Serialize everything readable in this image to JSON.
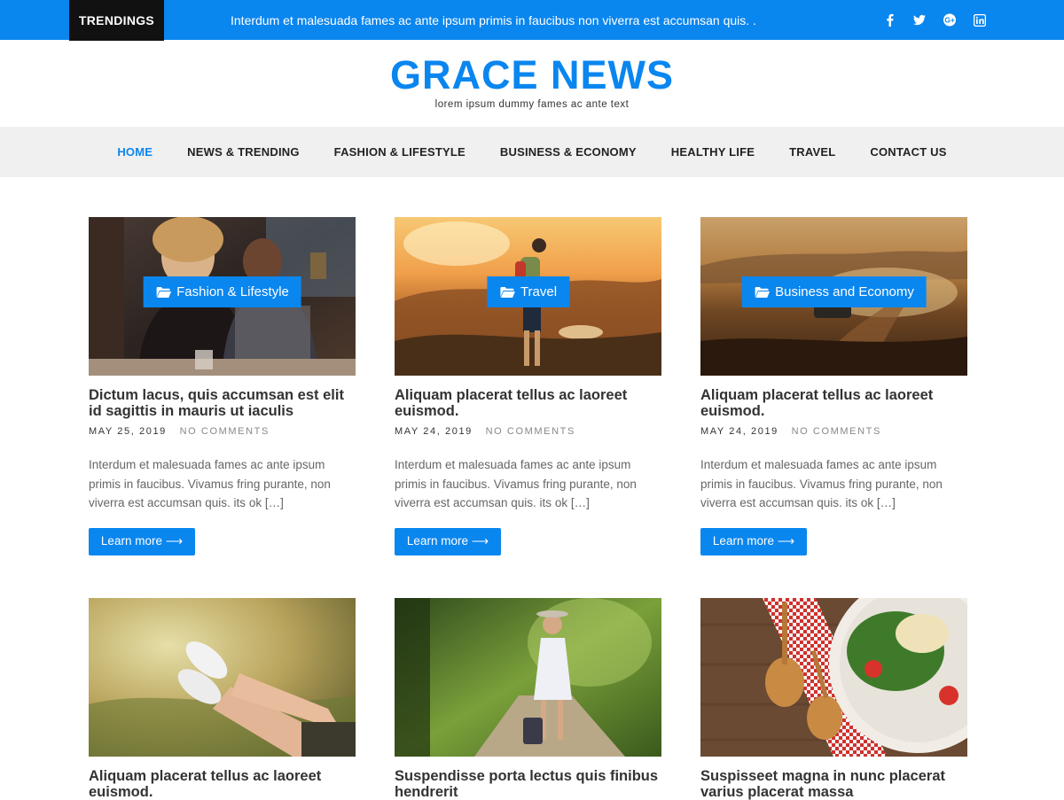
{
  "topbar": {
    "trending_label": "TRENDINGS",
    "ticker_text": "Interdum et malesuada fames ac ante ipsum primis in faucibus non viverra est accumsan quis. .",
    "social": [
      "facebook-icon",
      "twitter-icon",
      "google-plus-icon",
      "linkedin-icon"
    ],
    "bg_color": "#0a86ef"
  },
  "header": {
    "title": "GRACE NEWS",
    "tagline": "lorem ipsum dummy fames ac ante text"
  },
  "nav": {
    "items": [
      {
        "label": "HOME",
        "active": true
      },
      {
        "label": "NEWS & TRENDING",
        "active": false
      },
      {
        "label": "FASHION & LIFESTYLE",
        "active": false
      },
      {
        "label": "BUSINESS & ECONOMY",
        "active": false
      },
      {
        "label": "HEALTHY LIFE",
        "active": false
      },
      {
        "label": "TRAVEL",
        "active": false
      },
      {
        "label": "CONTACT US",
        "active": false
      }
    ]
  },
  "posts": [
    {
      "category": "Fashion & Lifestyle",
      "title": "Dictum lacus, quis accumsan est elit id sagittis in mauris ut iaculis",
      "date": "MAY 25, 2019",
      "comments": "NO COMMENTS",
      "excerpt": "Interdum et malesuada fames ac ante ipsum primis in faucibus. Vivamus fring purante, non viverra est accumsan quis. its ok […]",
      "button": "Learn more ⟶"
    },
    {
      "category": "Travel",
      "title": "Aliquam placerat tellus ac laoreet euismod.",
      "date": "MAY 24, 2019",
      "comments": "NO COMMENTS",
      "excerpt": "Interdum et malesuada fames ac ante ipsum primis in faucibus. Vivamus fring purante, non viverra est accumsan quis. its ok […]",
      "button": "Learn more ⟶"
    },
    {
      "category": "Business and Economy",
      "title": "Aliquam placerat tellus ac laoreet euismod.",
      "date": "MAY 24, 2019",
      "comments": "NO COMMENTS",
      "excerpt": "Interdum et malesuada fames ac ante ipsum primis in faucibus. Vivamus fring purante, non viverra est accumsan quis. its ok […]",
      "button": "Learn more ⟶"
    },
    {
      "title": "Aliquam placerat tellus ac laoreet euismod."
    },
    {
      "title": "Suspendisse porta lectus quis finibus hendrerit"
    },
    {
      "title": "Suspisseet magna in nunc placerat varius placerat massa"
    }
  ]
}
